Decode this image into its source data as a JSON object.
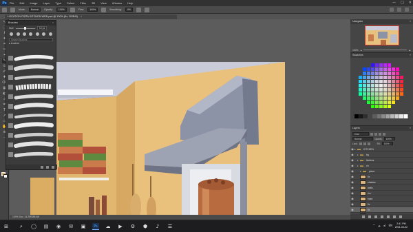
{
  "app": {
    "logo": "Ps",
    "menu": [
      "File",
      "Edit",
      "Image",
      "Layer",
      "Type",
      "Select",
      "Filter",
      "3D",
      "View",
      "Window",
      "Help"
    ],
    "window_controls": [
      "—",
      "□",
      "✕"
    ]
  },
  "options_bar": {
    "mode_label": "Mode:",
    "mode_value": "Normal",
    "opacity_label": "Opacity:",
    "opacity_value": "100%",
    "flow_label": "Flow:",
    "flow_value": "100%",
    "smoothing_label": "Smoothing:",
    "smoothing_value": "0%"
  },
  "document": {
    "tab_title": "LOCATION PIZZA KITCHEN WEB.psd @ 100% (fix, RGB/8)",
    "close": "×",
    "status": "100%    Doc: 14.2M/385.4M"
  },
  "toolbar": {
    "tools": [
      "↖",
      "⬚",
      "ℓ",
      "✦",
      "⌗",
      "✂",
      "⌖",
      "✎",
      "⊙",
      "✐",
      "♦",
      "⌫",
      "▦",
      "◐",
      "⌕",
      "✒",
      "T",
      "↗",
      "▭",
      "✋",
      "⊕",
      "···"
    ]
  },
  "brushes_panel": {
    "title": "Brushes",
    "close": "×",
    "size_label": "Size",
    "size_value": "10 px",
    "search_placeholder": "Search Brushes",
    "folder_name": "▸ brushes"
  },
  "navigator": {
    "title": "Navigator",
    "menu": "≡",
    "zoom_value": "100%"
  },
  "swatches": {
    "title": "Swatches",
    "menu": "≡"
  },
  "layers": {
    "title": "Layers",
    "menu": "≡",
    "filter_value": "Kind",
    "blend_value": "Normal",
    "opacity_label": "Opacity:",
    "opacity_value": "100%",
    "lock_label": "Lock:",
    "fill_label": "Fill:",
    "fill_value": "100%",
    "items": [
      {
        "name": "KITCHEN",
        "type": "folder",
        "indent": 0,
        "selected": false
      },
      {
        "name": "bg",
        "type": "folder",
        "indent": 1,
        "selected": false
      },
      {
        "name": "lineless",
        "type": "folder",
        "indent": 1,
        "selected": false
      },
      {
        "name": "ch",
        "type": "folder",
        "indent": 1,
        "selected": false
      },
      {
        "name": "pizza",
        "type": "folder",
        "indent": 2,
        "selected": false
      },
      {
        "name": "fix",
        "type": "layer",
        "indent": 2,
        "selected": false
      },
      {
        "name": "shadow",
        "type": "layer",
        "indent": 2,
        "selected": false
      },
      {
        "name": "walls",
        "type": "layer",
        "indent": 2,
        "selected": false
      },
      {
        "name": "rim",
        "type": "layer",
        "indent": 2,
        "selected": false
      },
      {
        "name": "base",
        "type": "layer",
        "indent": 2,
        "selected": false
      },
      {
        "name": "fix",
        "type": "layer",
        "indent": 2,
        "selected": false
      },
      {
        "name": "fix",
        "type": "layer",
        "indent": 2,
        "selected": true
      },
      {
        "name": "bg",
        "type": "layer",
        "indent": 2,
        "selected": false
      }
    ],
    "footer_icons": [
      "link-icon",
      "fx-icon",
      "mask-icon",
      "adjustment-icon",
      "group-icon",
      "new-layer-icon",
      "trash-icon"
    ]
  },
  "taskbar": {
    "start": "⊞",
    "apps": [
      "⌕",
      "◯",
      "▤",
      "◉",
      "✉",
      "▣",
      "Ps",
      "☁",
      "▶",
      "⚙",
      "⬢",
      "♪",
      "☰"
    ],
    "tray": [
      "^",
      "☁",
      "◂)",
      "EN"
    ],
    "time": "2:41 PM",
    "date": "2021-04-02"
  },
  "colors": {
    "wall": "#e9c07c",
    "ceiling": "#c9ccd8",
    "hood": "#8d93a6",
    "pot": "#b86b3e"
  }
}
